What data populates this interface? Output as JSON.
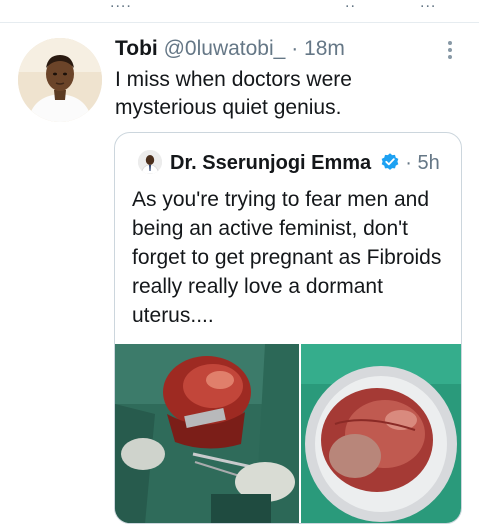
{
  "tweet": {
    "name": "Tobi",
    "handle": "@0luwatobi_",
    "separator": "·",
    "time": "18m",
    "text": "I miss when doctors were mysterious quiet genius.",
    "more_icon": "more-vertical-icon"
  },
  "quoted_tweet": {
    "name": "Dr. Sserunjogi Emma",
    "separator": "·",
    "time": "5h",
    "verified_icon": "verified-badge-icon",
    "text": "As you're trying to fear men and being an active feminist, don't forget to get pregnant as Fibroids really really love a dormant uterus....",
    "media_count": 2
  },
  "colors": {
    "text": "#14171a",
    "secondary": "#657786",
    "border": "#ccd6dd",
    "verified": "#1da1f2"
  }
}
